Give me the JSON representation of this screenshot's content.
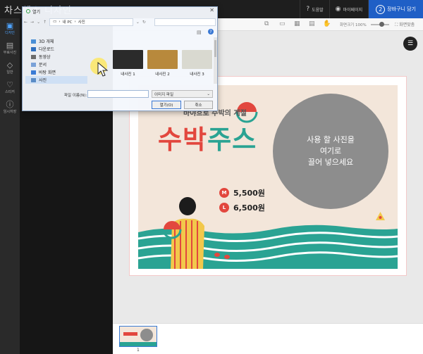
{
  "app": {
    "title": "차스웨스 디자인"
  },
  "top_actions": {
    "help": "도움말",
    "mydesign": "마이페이지",
    "cart_step": "2",
    "cart": "장바구니 담기"
  },
  "rail": [
    {
      "label": "디자인",
      "icon": "image-icon",
      "glyph": "▣"
    },
    {
      "label": "무료사진",
      "icon": "photo-icon",
      "glyph": "▤"
    },
    {
      "label": "일반",
      "icon": "shape-icon",
      "glyph": "◇"
    },
    {
      "label": "스티커",
      "icon": "heart-icon",
      "glyph": "♡"
    },
    {
      "label": "임시저장",
      "icon": "info-icon",
      "glyph": "ⓘ"
    }
  ],
  "toolbar": {
    "zoom_label": "화면크기 100%",
    "fit_label": "화면맞춤"
  },
  "design": {
    "tagline": "바야흐로 수박의 계절",
    "headline_red": "수박",
    "headline_green": "주스",
    "photo_text_1": "사용 할 사진을",
    "photo_text_2": "여기로",
    "photo_text_3": "끌어 넣으세요",
    "prices": [
      {
        "size": "M",
        "price": "5,500원"
      },
      {
        "size": "L",
        "price": "6,500원"
      }
    ]
  },
  "pages": {
    "current": "1"
  },
  "dialog": {
    "title": "열기",
    "path": [
      "내 PC",
      "사진"
    ],
    "tree": [
      {
        "label": "3D 개체",
        "color": "#4a8fd6"
      },
      {
        "label": "다운로드",
        "color": "#2f6fbf"
      },
      {
        "label": "동영상",
        "color": "#6b6b6b"
      },
      {
        "label": "문서",
        "color": "#7aa2d8"
      },
      {
        "label": "바탕 화면",
        "color": "#3a7bd5"
      },
      {
        "label": "사진",
        "color": "#5a8cc6"
      }
    ],
    "files": [
      {
        "name": "내사진 1",
        "color": "#2b2b2b"
      },
      {
        "name": "내사진 2",
        "color": "#b8893c"
      },
      {
        "name": "내사진 3",
        "color": "#d9d9d0"
      }
    ],
    "filename_label": "파일 이름(N):",
    "filename_value": "",
    "filetype": "이미지 파일",
    "open_label": "열기(O)",
    "cancel_label": "취소"
  },
  "colors": {
    "accent": "#1f5fc6",
    "red": "#e2473e",
    "teal": "#2aa393"
  }
}
